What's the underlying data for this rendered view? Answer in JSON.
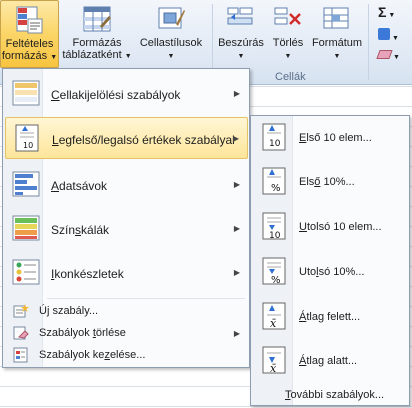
{
  "ribbon": {
    "buttons": {
      "conditional_formatting": {
        "line1": "Feltételes",
        "line2": "formázás",
        "icon": "conditional-formatting-icon"
      },
      "format_as_table": {
        "line1": "Formázás",
        "line2": "táblázatként",
        "icon": "format-table-icon"
      },
      "cell_styles": {
        "line1": "Cellastílusok",
        "icon": "cell-styles-icon"
      },
      "insert": {
        "line1": "Beszúrás",
        "icon": "insert-cells-icon"
      },
      "delete": {
        "line1": "Törlés",
        "icon": "delete-cells-icon"
      },
      "format": {
        "line1": "Formátum",
        "icon": "format-cells-icon"
      }
    },
    "group_cells_label": "Cellák",
    "autosum_glyph": "Σ"
  },
  "menu": {
    "items": [
      {
        "label": "Cellakijelölési szabályok",
        "underline_index": 0,
        "icon": "highlight-cells-icon",
        "has_submenu": true
      },
      {
        "label": "Legfelső/legalsó értékek szabályai",
        "underline_index": 0,
        "icon": "top-bottom-rules-icon",
        "has_submenu": true,
        "highlighted": true
      },
      {
        "label": "Adatsávok",
        "underline_index": 0,
        "icon": "data-bars-icon",
        "has_submenu": true
      },
      {
        "label": "Színskálák",
        "underline_index": 4,
        "icon": "color-scales-icon",
        "has_submenu": true
      },
      {
        "label": "Ikonkészletek",
        "underline_index": 0,
        "icon": "icon-sets-icon",
        "has_submenu": true
      }
    ],
    "small_items": [
      {
        "label": "Új szabály...",
        "icon": "new-rule-icon",
        "has_submenu": false
      },
      {
        "label": "Szabályok törlése",
        "icon": "clear-rules-icon",
        "has_submenu": true
      },
      {
        "label": "Szabályok kezelése...",
        "icon": "manage-rules-icon",
        "has_submenu": false
      }
    ]
  },
  "submenu": {
    "items": [
      {
        "label": "Első 10 elem...",
        "icon": "top-10-items-icon"
      },
      {
        "label": "Első 10%...",
        "icon": "top-10-percent-icon"
      },
      {
        "label": "Utolsó 10 elem...",
        "icon": "bottom-10-items-icon"
      },
      {
        "label": "Utolsó 10%...",
        "icon": "bottom-10-percent-icon"
      },
      {
        "label": "Átlag felett...",
        "icon": "above-average-icon"
      },
      {
        "label": "Átlag alatt...",
        "icon": "below-average-icon"
      }
    ],
    "more_rules": "További szabályok..."
  },
  "icon_text": {
    "ten": "10",
    "percent": "%",
    "xbar": "x̄"
  },
  "colors": {
    "highlight_bg": "#fde59a",
    "ribbon_bg": "#dfe8f4",
    "menu_border": "#8f9db0"
  }
}
